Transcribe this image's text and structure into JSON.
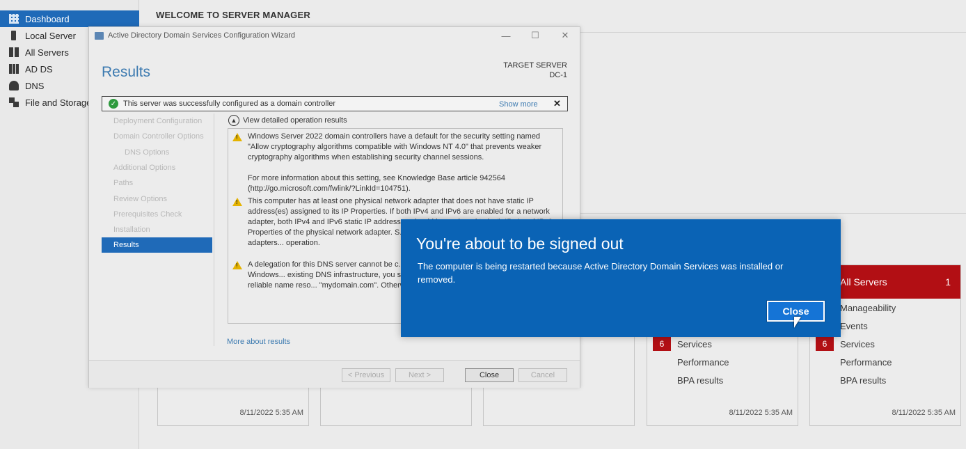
{
  "nav": {
    "items": [
      {
        "label": "Dashboard",
        "icon": "dashboard-icon",
        "active": true
      },
      {
        "label": "Local Server",
        "icon": "server-icon"
      },
      {
        "label": "All Servers",
        "icon": "servers-icon"
      },
      {
        "label": "AD DS",
        "icon": "adds-icon"
      },
      {
        "label": "DNS",
        "icon": "dns-icon"
      },
      {
        "label": "File and Storage",
        "icon": "file-storage-icon"
      }
    ]
  },
  "header": {
    "title": "WELCOME TO SERVER MANAGER"
  },
  "tiles": [
    {
      "timestamp": "8/11/2022 5:35 AM"
    },
    {
      "timestamp": ""
    },
    {
      "timestamp": ""
    },
    {
      "timestamp": "8/11/2022 5:35 AM",
      "rows": [
        "Services",
        "Performance",
        "BPA results"
      ],
      "badge": "6"
    },
    {
      "timestamp": "8/11/2022 5:35 AM",
      "title": "All Servers",
      "count": "1",
      "rows": [
        "Manageability",
        "Events",
        "Services",
        "Performance",
        "BPA results"
      ],
      "badge": "6"
    }
  ],
  "wizard": {
    "window_title": "Active Directory Domain Services Configuration Wizard",
    "heading": "Results",
    "target_label": "TARGET SERVER",
    "target_name": "DC-1",
    "success_message": "This server was successfully configured as a domain controller",
    "show_more": "Show more",
    "steps": [
      {
        "label": "Deployment Configuration"
      },
      {
        "label": "Domain Controller Options"
      },
      {
        "label": "DNS Options",
        "sub": true
      },
      {
        "label": "Additional Options"
      },
      {
        "label": "Paths"
      },
      {
        "label": "Review Options"
      },
      {
        "label": "Prerequisites Check"
      },
      {
        "label": "Installation"
      },
      {
        "label": "Results",
        "active": true
      }
    ],
    "toggle_label": "View detailed operation results",
    "results": [
      "Windows Server 2022 domain controllers have a default for the security setting named \"Allow cryptography algorithms compatible with Windows NT 4.0\" that prevents weaker cryptography algorithms when establishing security channel sessions.\n\nFor more information about this setting, see Knowledge Base article 942564 (http://go.microsoft.com/fwlink/?LinkId=104751).",
      "This computer has at least one physical network adapter that does not have static IP address(es) assigned to its IP Properties. If both IPv4 and IPv6 are enabled for a network adapter, both IPv4 and IPv6 static IP addresses should be assigned to both IPv4 and IPv6 Properties of the physical network adapter. S... be done to all the physical network adapters... operation.",
      "A delegation for this DNS server cannot be c... cannot be found or it does not run Windows... existing DNS infrastructure, you should manu... the parent zone to ensure reliable name reso... \"mydomain.com\". Otherwise, no action is req..."
    ],
    "more_results": "More about results",
    "buttons": {
      "previous": "< Previous",
      "next": "Next >",
      "close": "Close",
      "cancel": "Cancel"
    }
  },
  "modal": {
    "title": "You're about to be signed out",
    "message": "The computer is being restarted because Active Directory Domain Services was installed or removed.",
    "close": "Close"
  },
  "colors": {
    "accent": "#1f6ab8",
    "modal_bg": "#0a63b5",
    "alert_red": "#b20f14",
    "success_green": "#2e9a3e",
    "warning_yellow": "#e5b300"
  }
}
